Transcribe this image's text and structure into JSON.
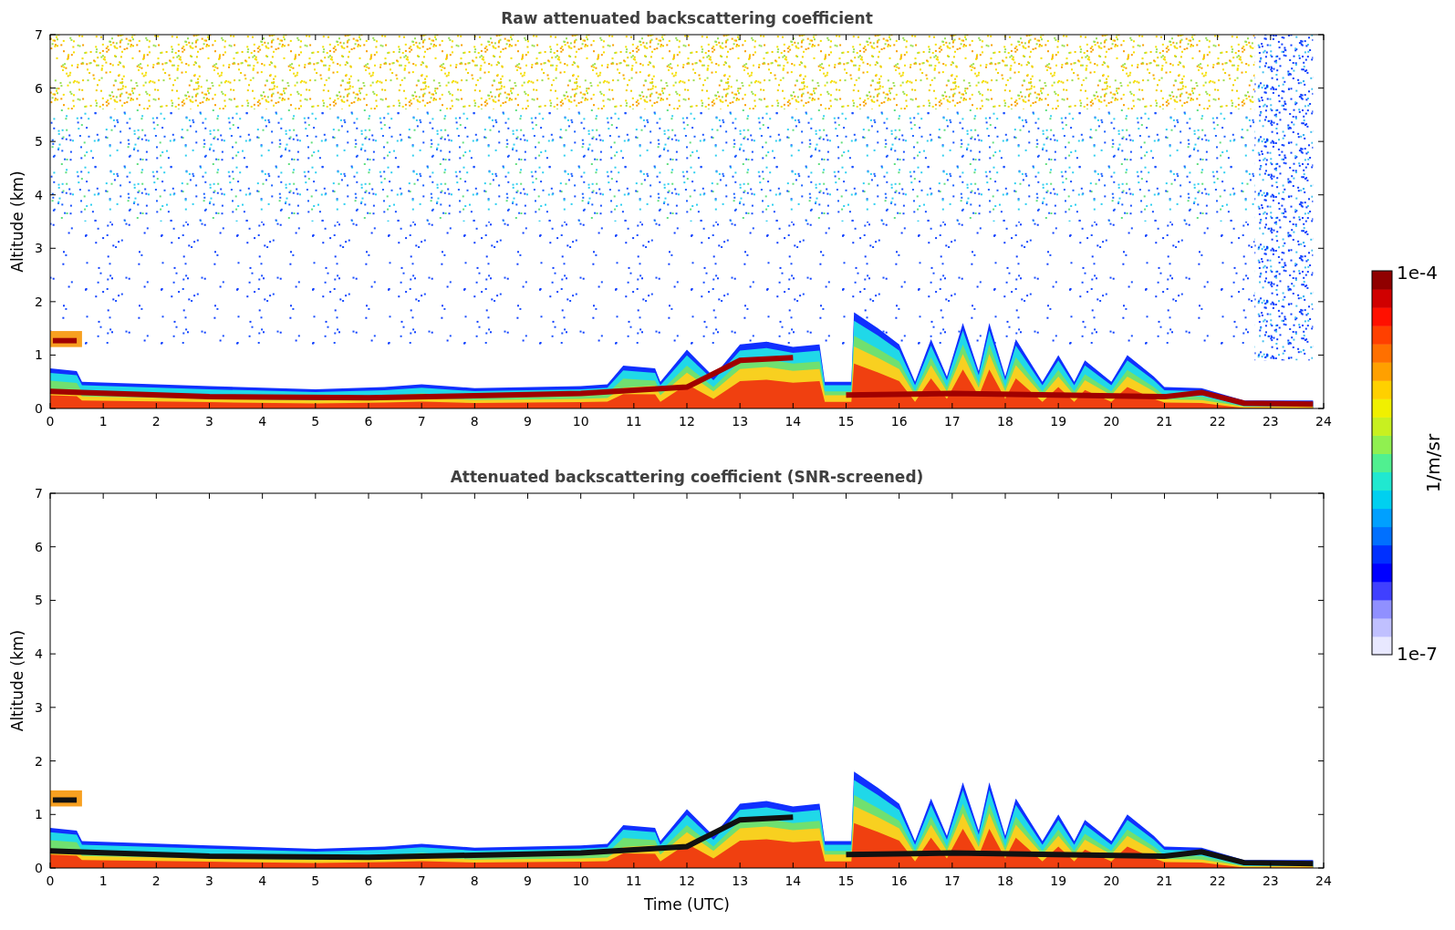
{
  "panels": [
    {
      "kind": "raw",
      "title": "Raw attenuated backscattering coefficient",
      "ylabel": "Altitude (km)",
      "yticks": [
        "7",
        "6",
        "5",
        "4",
        "3",
        "2",
        "1",
        "0"
      ],
      "xticks": [
        "0",
        "1",
        "2",
        "3",
        "4",
        "5",
        "6",
        "7",
        "8",
        "9",
        "10",
        "11",
        "12",
        "13",
        "14",
        "15",
        "16",
        "17",
        "18",
        "19",
        "20",
        "21",
        "22",
        "23",
        "24"
      ]
    },
    {
      "kind": "screened",
      "title": "Attenuated backscattering coefficient (SNR-screened)",
      "ylabel": "Altitude (km)",
      "yticks": [
        "7",
        "6",
        "5",
        "4",
        "3",
        "2",
        "1",
        "0"
      ],
      "xticks": [
        "0",
        "1",
        "2",
        "3",
        "4",
        "5",
        "6",
        "7",
        "8",
        "9",
        "10",
        "11",
        "12",
        "13",
        "14",
        "15",
        "16",
        "17",
        "18",
        "19",
        "20",
        "21",
        "22",
        "23",
        "24"
      ],
      "xlabel": "Time (UTC)"
    }
  ],
  "colorbar": {
    "max": "1e-4",
    "min": "1e-7",
    "label": "1/m/sr"
  }
}
